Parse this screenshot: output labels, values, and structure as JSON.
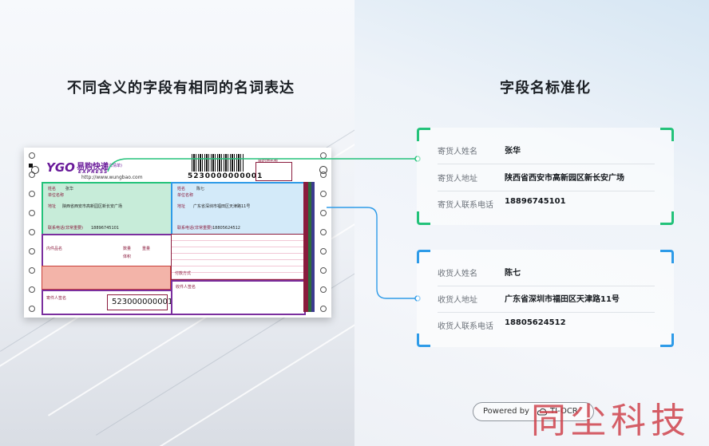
{
  "left_heading": "不同含义的字段有相同的名词表达",
  "right_heading": "字段名标准化",
  "colors": {
    "green": "#23c27a",
    "blue": "#2e9be8",
    "accent_red": "#b0123a"
  },
  "waybill": {
    "logo": "YGO",
    "brand": "易购快递",
    "brand_sub": "EXPRESS",
    "detail_tag": "(详情单)",
    "url": "http://www.wungbao.com",
    "barcode_number": "5230000000001",
    "barcode_number_bottom": "523000000001",
    "dest_label": "目的地名称",
    "sender": {
      "name_label": "姓名",
      "name": "张华",
      "company_label": "单位名称",
      "address_label": "地址",
      "address": "陕西省西安市高新园区新长安广场",
      "phone_label": "联系电话(非常重要)",
      "phone": "18896745101"
    },
    "receiver": {
      "name_label": "姓名",
      "name": "陈七",
      "company_label": "单位名称",
      "address_label": "地址",
      "address": "广东省深圳市福田区天津路11号",
      "phone_label": "联系电话(非常重要)",
      "phone": "18805624512"
    },
    "misc": {
      "item_name": "内件品名",
      "quantity": "数量",
      "weight": "重量",
      "volume": "体积",
      "pay_method": "付款方式",
      "sign_label": "收件人签名",
      "sign_label2": "寄件人签名"
    }
  },
  "sender_card": {
    "rows": [
      {
        "label": "寄货人姓名",
        "value": "张华"
      },
      {
        "label": "寄货人地址",
        "value": "陕西省西安市高新园区新长安广场"
      },
      {
        "label": "寄货人联系电话",
        "value": "18896745101"
      }
    ]
  },
  "receiver_card": {
    "rows": [
      {
        "label": "收货人姓名",
        "value": "陈七"
      },
      {
        "label": "收货人地址",
        "value": "广东省深圳市福田区天津路11号"
      },
      {
        "label": "收货人联系电话",
        "value": "18805624512"
      }
    ]
  },
  "powered": {
    "prefix": "Powered by",
    "brand": "TI-OCR",
    "logo_icon": "cloud-logo-icon"
  },
  "watermark": "同尘科技"
}
